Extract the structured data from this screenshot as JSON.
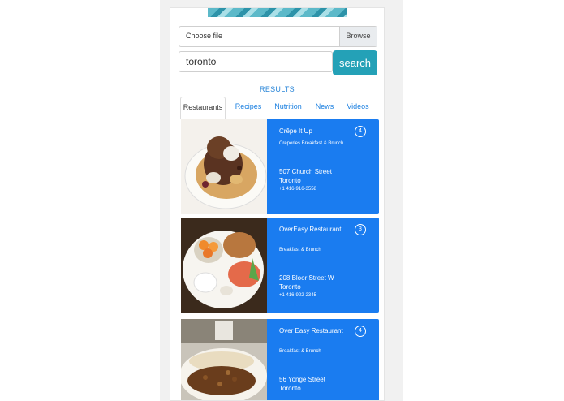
{
  "upload": {
    "choose_label": "Choose file",
    "browse_label": "Browse"
  },
  "search": {
    "value": "toronto",
    "button_label": "search"
  },
  "results": {
    "label": "RESULTS",
    "tabs": [
      {
        "label": "Restaurants",
        "active": true
      },
      {
        "label": "Recipes"
      },
      {
        "label": "Nutrition"
      },
      {
        "label": "News"
      },
      {
        "label": "Videos"
      }
    ]
  },
  "restaurants": [
    {
      "name": "Crêpe It Up",
      "categories": "Creperies  Breakfast & Brunch",
      "street": "507 Church Street",
      "city": "Toronto",
      "phone": "+1 416-916-3558",
      "rating": "4"
    },
    {
      "name": "OverEasy Restaurant",
      "categories": "Breakfast & Brunch",
      "street": "208 Bloor Street W",
      "city": "Toronto",
      "phone": "+1 416-922-2345",
      "rating": "3"
    },
    {
      "name": "Over Easy Restaurant",
      "categories": "Breakfast & Brunch",
      "street": "56 Yonge Street",
      "city": "Toronto",
      "phone": "",
      "rating": "4"
    }
  ]
}
